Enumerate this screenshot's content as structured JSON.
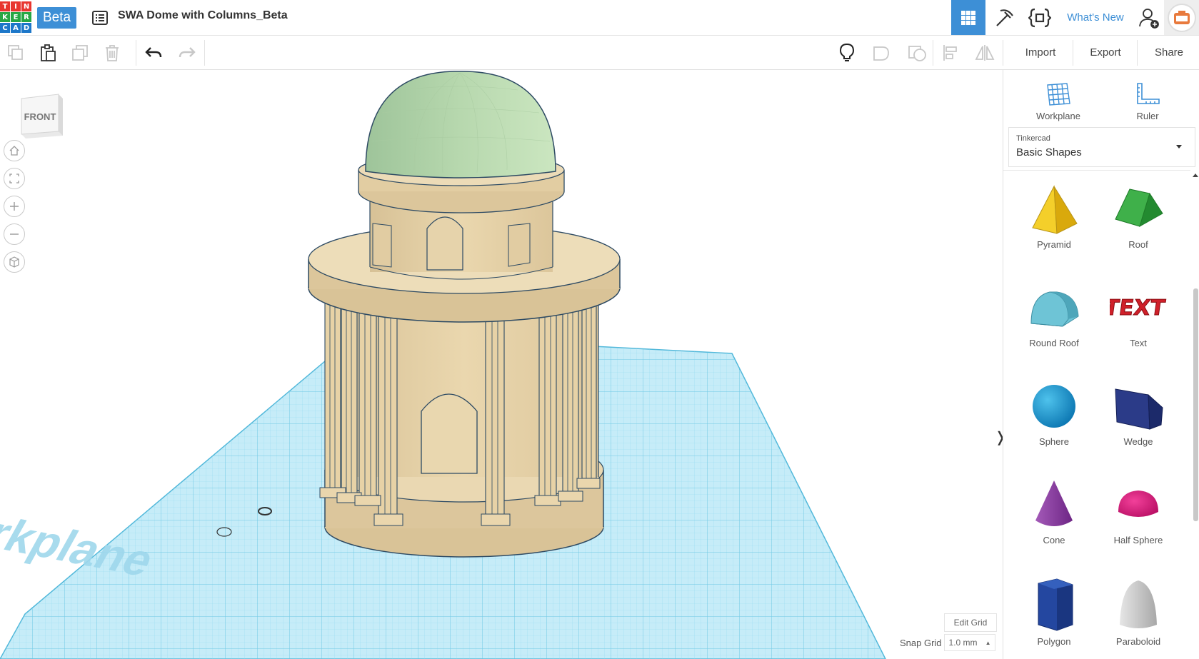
{
  "app": {
    "logo_letters": [
      "T",
      "I",
      "N",
      "K",
      "E",
      "R",
      "C",
      "A",
      "D"
    ],
    "logo_colors": [
      "#e8352f",
      "#e8352f",
      "#e8352f",
      "#27a744",
      "#27a744",
      "#27a744",
      "#1d77c9",
      "#1d77c9",
      "#1d77c9"
    ],
    "beta_label": "Beta",
    "document_title": "SWA Dome with Columns_Beta",
    "accent_color": "#3d8fd6"
  },
  "topnav": {
    "whats_new": "What's New",
    "icons": [
      "grid-view-icon",
      "pickaxe-icon",
      "code-blocks-icon",
      "add-user-icon",
      "avatar"
    ]
  },
  "toolbar": {
    "icons": [
      "copy-icon",
      "paste-icon",
      "duplicate-icon",
      "delete-icon",
      "undo-icon",
      "redo-icon",
      "notes-lightbulb-icon",
      "group-icon",
      "ungroup-icon",
      "align-icon",
      "mirror-icon"
    ],
    "import_label": "Import",
    "export_label": "Export",
    "share_label": "Share"
  },
  "viewport": {
    "viewcube_label": "FRONT",
    "workplane_label": "Workplane",
    "view_controls": [
      "home-view",
      "fit-all",
      "zoom-in",
      "zoom-out",
      "ortho-perspective"
    ],
    "edit_grid_label": "Edit Grid",
    "snap_grid_label": "Snap Grid",
    "snap_grid_value": "1.0 mm",
    "grid_color": "#7fd3ec",
    "model_color": "#e8d3a8",
    "dome_color": "#bcdcb2"
  },
  "panel": {
    "workplane_label": "Workplane",
    "ruler_label": "Ruler",
    "library_source": "Tinkercad",
    "library_name": "Basic Shapes",
    "shapes": [
      {
        "label": "Pyramid",
        "color": "#f1c40f"
      },
      {
        "label": "Roof",
        "color": "#2e9e3a"
      },
      {
        "label": "Round Roof",
        "color": "#5fb3c7"
      },
      {
        "label": "Text",
        "color": "#d0202a"
      },
      {
        "label": "Sphere",
        "color": "#1b93d1"
      },
      {
        "label": "Wedge",
        "color": "#22337a"
      },
      {
        "label": "Cone",
        "color": "#8e3aa6"
      },
      {
        "label": "Half Sphere",
        "color": "#e0197a"
      },
      {
        "label": "Polygon",
        "color": "#1e3f8c"
      },
      {
        "label": "Paraboloid",
        "color": "#cccccc"
      }
    ]
  }
}
